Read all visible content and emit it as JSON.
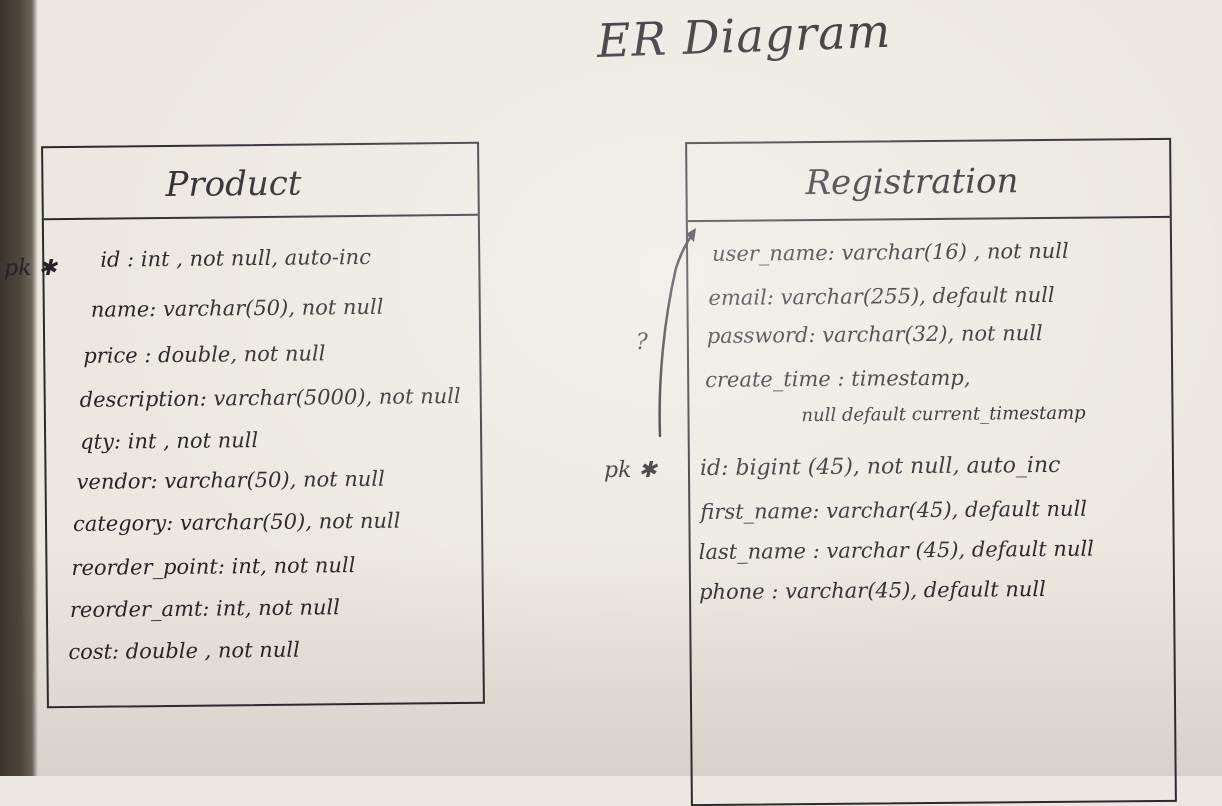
{
  "title": "ER Diagram",
  "entities": [
    {
      "name": "Product",
      "primary_key_marker": "pk ✱",
      "attributes": [
        "id : int , not null, auto-inc",
        "name: varchar(50), not null",
        "price : double, not null",
        "description: varchar(5000), not null",
        "qty: int , not null",
        "vendor: varchar(50), not null",
        "category: varchar(50), not null",
        "reorder_point: int, not null",
        "reorder_amt: int, not null",
        "cost: double , not null"
      ]
    },
    {
      "name": "Registration",
      "primary_key_marker": "pk ✱",
      "question_mark": "?",
      "attributes": [
        "user_name: varchar(16) , not null",
        "email: varchar(255), default null",
        "password: varchar(32), not null",
        "create_time : timestamp,",
        "null default current_timestamp",
        "id: bigint (45), not null, auto_inc",
        "first_name: varchar(45), default null",
        "last_name : varchar (45), default null",
        "phone : varchar(45), default null"
      ]
    }
  ]
}
